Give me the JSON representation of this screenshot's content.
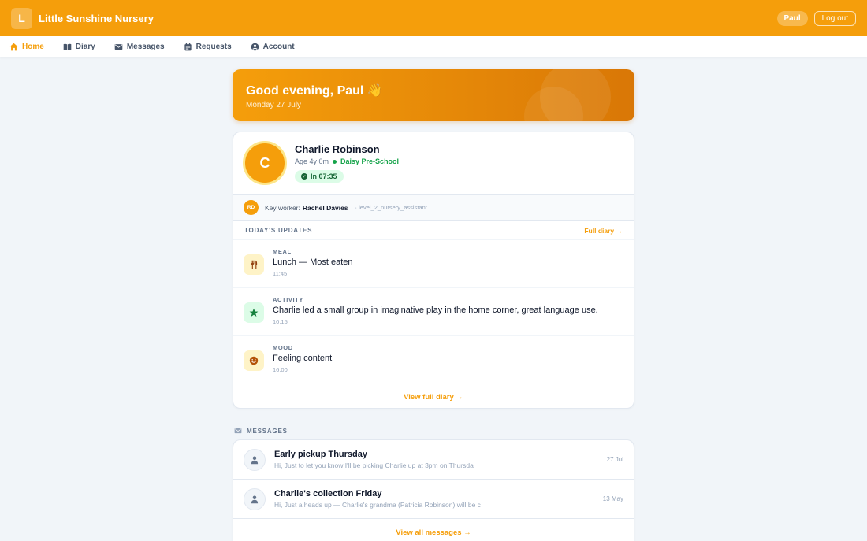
{
  "header": {
    "logo_letter": "L",
    "app_title": "Little Sunshine Nursery",
    "user_name": "Paul",
    "logout_label": "Log out",
    "accent": "#f59e0b"
  },
  "nav": {
    "items": [
      {
        "label": "Home",
        "icon": "home-icon",
        "active": true
      },
      {
        "label": "Diary",
        "icon": "book-icon",
        "active": false
      },
      {
        "label": "Messages",
        "icon": "envelope-icon",
        "active": false
      },
      {
        "label": "Requests",
        "icon": "calendar-icon",
        "active": false
      },
      {
        "label": "Account",
        "icon": "user-circle-icon",
        "active": false
      }
    ]
  },
  "greeting": {
    "title": "Good evening, Paul 👋",
    "date": "Monday 27 July"
  },
  "child": {
    "initial": "C",
    "name": "Charlie Robinson",
    "age": "Age 4y 0m",
    "room": "Daisy Pre-School",
    "status": "In 07:35",
    "keyworker_label": "Key worker:",
    "keyworker_initials": "RD",
    "keyworker_name": "Rachel Davies",
    "keyworker_role": "· level_2_nursery_assistant"
  },
  "updates": {
    "section_label": "TODAY'S UPDATES",
    "full_diary_link": "Full diary →",
    "items": [
      {
        "type": "MEAL",
        "text": "Lunch — Most eaten",
        "time": "11:45",
        "icon": "utensils-icon",
        "bg": "#fef3c7",
        "fg": "#92400e"
      },
      {
        "type": "ACTIVITY",
        "text": "Charlie led a small group in imaginative play in the home corner, great language use.",
        "time": "10:15",
        "icon": "star-icon",
        "bg": "#dcfce7",
        "fg": "#15803d"
      },
      {
        "type": "MOOD",
        "text": "Feeling content",
        "time": "16:00",
        "icon": "smile-icon",
        "bg": "#fef3c7",
        "fg": "#b45309"
      }
    ],
    "footer_link": "View full diary →"
  },
  "messages": {
    "section_label": "MESSAGES",
    "items": [
      {
        "subject": "Early pickup Thursday",
        "preview": "Hi, Just to let you know I'll be picking Charlie up at 3pm on Thursda",
        "date": "27 Jul"
      },
      {
        "subject": "Charlie's collection Friday",
        "preview": "Hi, Just a heads up — Charlie's grandma (Patricia Robinson) will be c",
        "date": "13 May"
      }
    ],
    "footer_link": "View all messages →"
  }
}
